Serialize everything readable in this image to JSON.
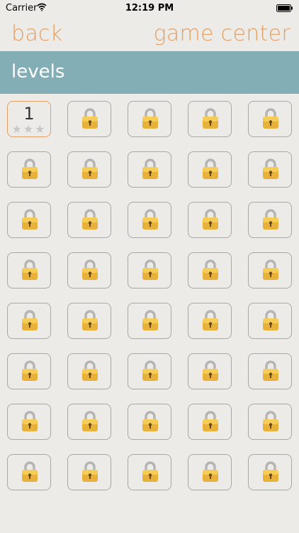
{
  "status_bar": {
    "carrier": "Carrier",
    "time": "12:19 PM"
  },
  "nav": {
    "back_label": "back",
    "game_center_label": "game center"
  },
  "header": {
    "title": "levels"
  },
  "grid": {
    "columns": 5,
    "rows": 8,
    "unlocked_level": {
      "number": "1",
      "stars": "★★★"
    },
    "locked_icon": "lock-icon"
  },
  "colors": {
    "background": "#ecebe7",
    "accent": "#e3a066",
    "header_bar": "#84aeb6",
    "cell_border": "#a9a8a6",
    "star_empty": "#c9c8c6"
  }
}
